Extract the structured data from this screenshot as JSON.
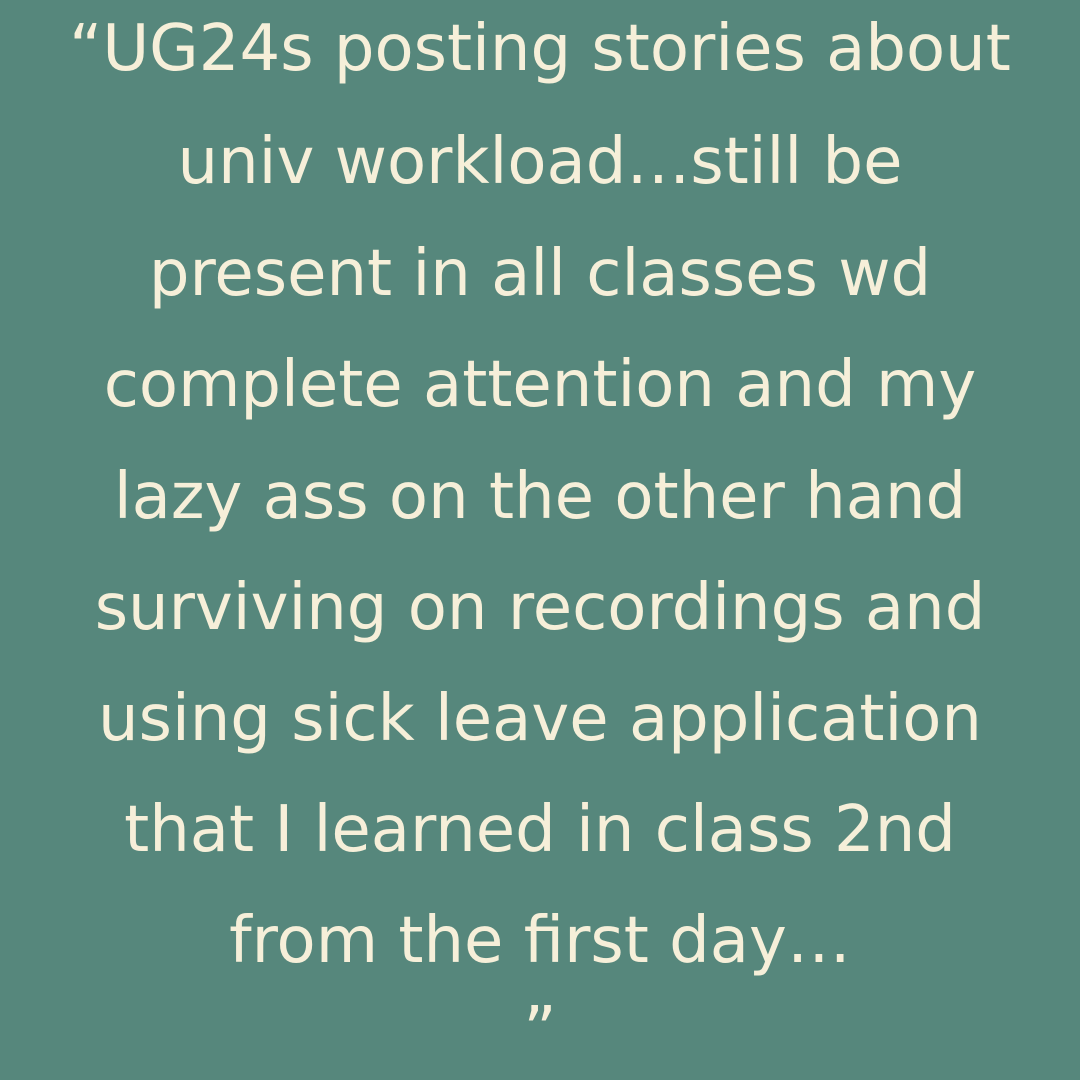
{
  "background_color": "#56877c",
  "text_color": "#f6efd9",
  "quote": {
    "lines": [
      "“UG24s posting stories about",
      "univ workload…still be",
      "present in all classes wd",
      "complete attention and my",
      "lazy ass on the other hand",
      "surviving on recordings and",
      "using sick leave application",
      "that I learned in class 2nd",
      "from the first day…",
      "”"
    ]
  }
}
